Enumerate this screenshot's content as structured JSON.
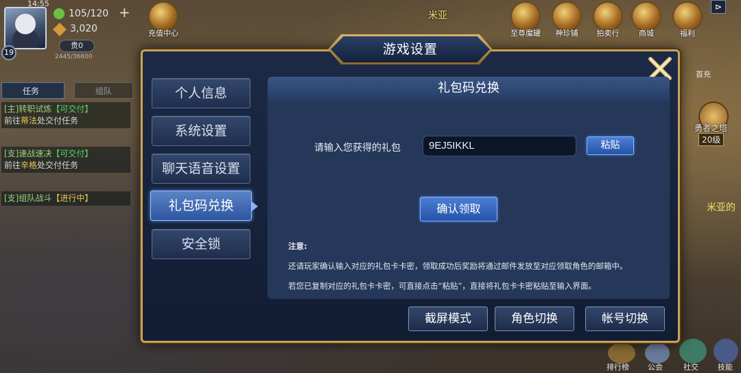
{
  "hud": {
    "time": "14:55",
    "level": "19",
    "stamina": "105/120",
    "gold": "3,020",
    "vip": "贵0",
    "exp": "2445/36600",
    "task_tab": "任务",
    "team_tab": "组队",
    "quests": [
      {
        "title": "[主]转职试炼",
        "status": "【可交付】",
        "desc_prefix": "前往",
        "desc_name": "蒂法",
        "desc_suffix": "处交付任务"
      },
      {
        "title": "[支]速战速决",
        "status": "【可交付】",
        "desc_prefix": "前往",
        "desc_name": "辛格",
        "desc_suffix": "处交付任务"
      },
      {
        "title": "[支]组队战斗",
        "status": "【进行中】"
      }
    ],
    "top_icons": [
      "充值中心",
      "至尊魔罐",
      "神珍铺",
      "拍卖行",
      "商城",
      "福利"
    ],
    "npc_name": "米亚",
    "right_labels": [
      "首充",
      "勇者之塔",
      "20级",
      "米亚的"
    ],
    "bottom_labels": [
      "排行榜",
      "公会",
      "社交",
      "技能"
    ]
  },
  "modal": {
    "title": "游戏设置",
    "nav": [
      {
        "label": "个人信息"
      },
      {
        "label": "系统设置"
      },
      {
        "label": "聊天语音设置"
      },
      {
        "label": "礼包码兑换",
        "active": true
      },
      {
        "label": "安全锁"
      }
    ],
    "panel_title": "礼包码兑换",
    "input_label": "请输入您获得的礼包",
    "input_value": "9EJ5IKKL",
    "paste_label": "粘贴",
    "confirm_label": "确认领取",
    "note_title": "注意:",
    "note_line1": "还请玩家确认输入对应的礼包卡卡密，领取成功后奖励将通过邮件发放至对应领取角色的邮箱中。",
    "note_line2": "若您已复制对应的礼包卡卡密，可直接点击“粘贴”，直接将礼包卡卡密粘贴至输入界面。",
    "bottom_buttons": [
      "截屏模式",
      "角色切换",
      "帐号切换"
    ]
  }
}
